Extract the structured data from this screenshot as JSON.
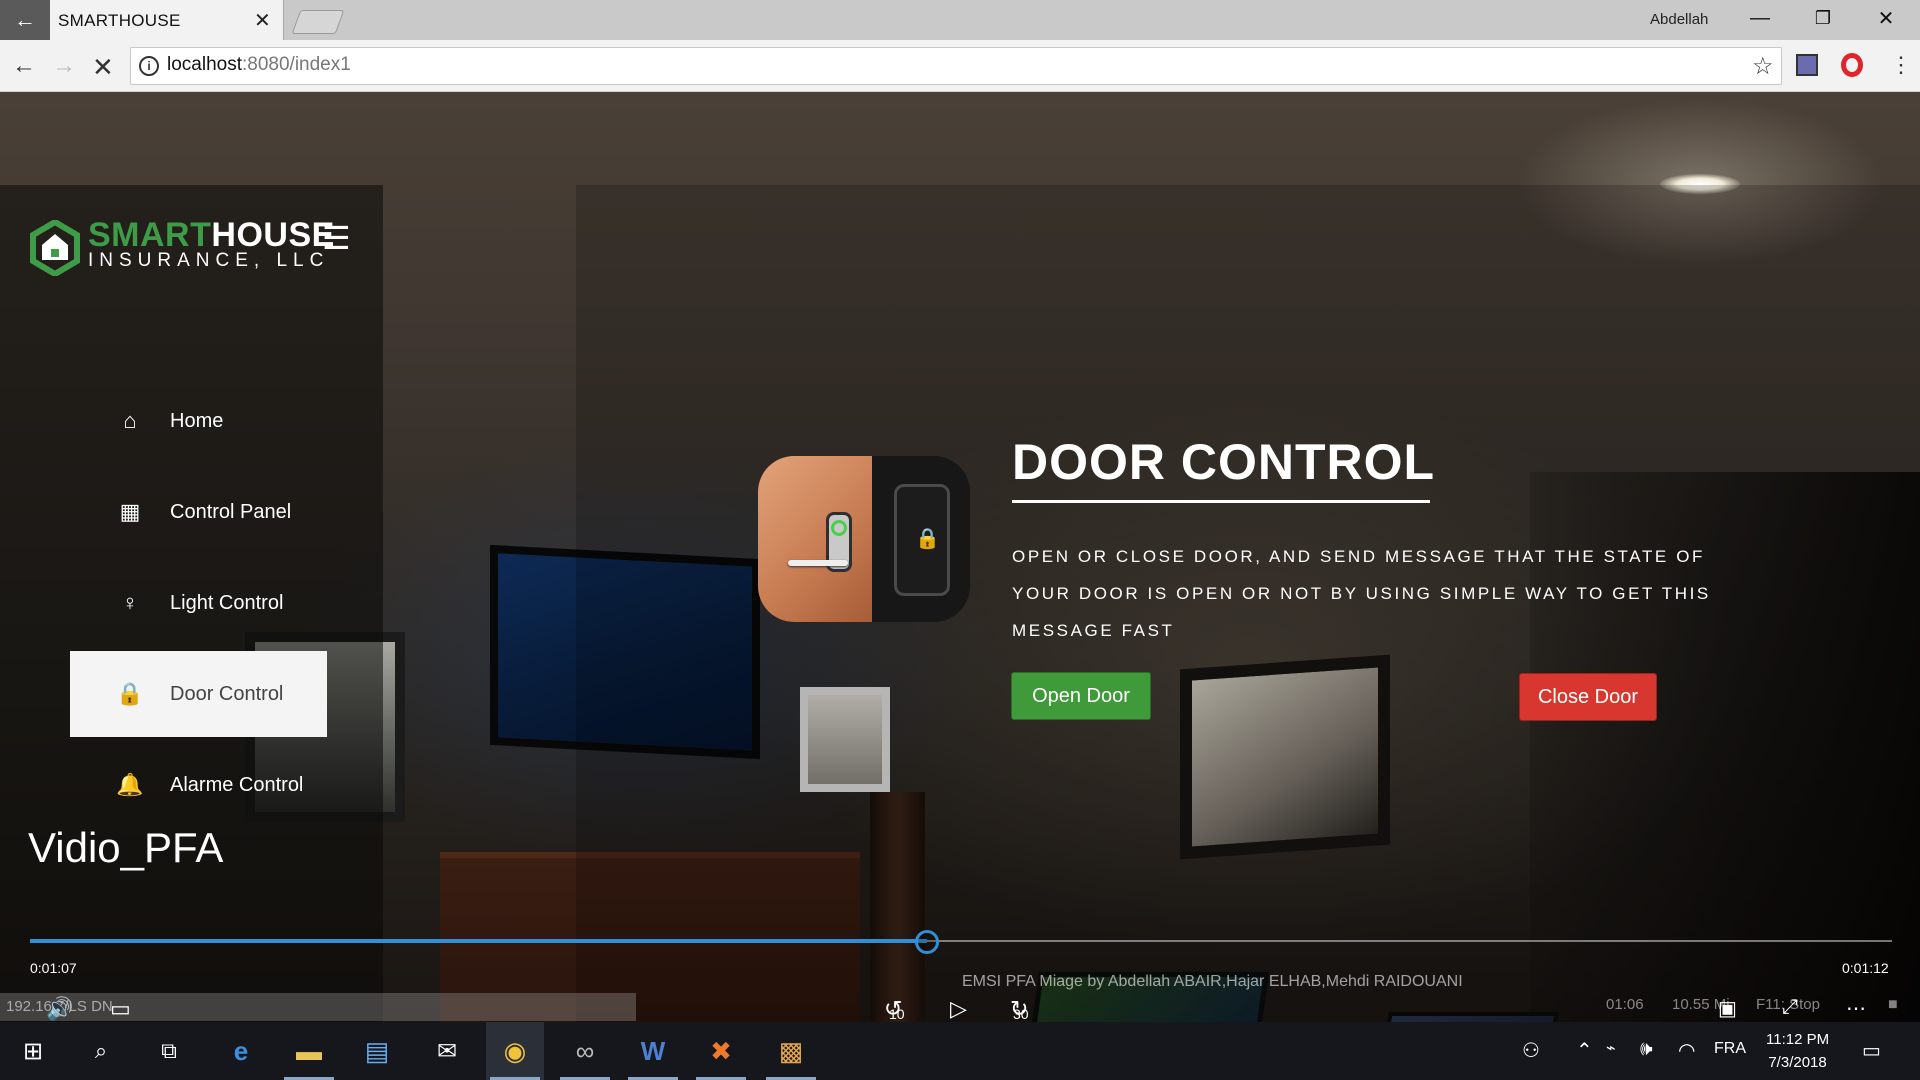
{
  "browser": {
    "tab_title": "SMARTHOUSE",
    "tab_close": "✕",
    "user": "Abdellah",
    "url_host": "localhost",
    "url_path": ":8080/index1",
    "window_controls": {
      "minimize": "—",
      "restore": "❐",
      "close": "✕"
    }
  },
  "logo": {
    "brand_green": "SMART",
    "brand_white": "HOUSE",
    "subtitle": "INSURANCE, LLC",
    "color": "#3e9b47"
  },
  "sidebar": {
    "items": [
      {
        "label": "Home",
        "icon": "home-icon",
        "glyph": "⌂"
      },
      {
        "label": "Control Panel",
        "icon": "grid-icon",
        "glyph": "▦"
      },
      {
        "label": "Light Control",
        "icon": "lightbulb-icon",
        "glyph": "♀"
      },
      {
        "label": "Door Control",
        "icon": "lock-icon",
        "glyph": "🔒"
      },
      {
        "label": "Alarme Control",
        "icon": "bell-icon",
        "glyph": "🔔"
      }
    ],
    "active_index": 3
  },
  "main": {
    "title": "DOOR CONTROL",
    "description": "Open or close door, and send message that the state of your door is open or not by using simple way to get this message fast",
    "open_button": "Open Door",
    "close_button": "Close Door",
    "open_color": "#3f9a3a",
    "close_color": "#d8372f"
  },
  "video": {
    "title": "Vidio_PFA",
    "elapsed": "0:01:07",
    "remaining": "0:01:12",
    "progress_fraction": 0.482,
    "credits": "EMSI PFA Miage by Abdellah ABAIR,Hajar ELHAB,Mehdi RAIDOUANI",
    "status_text": "192.16   7/LS   DN",
    "rewind_label": "10",
    "forward_label": "30",
    "tray_left": "01:06",
    "tray_mid": "10.55 Mi",
    "tray_right": "F11: Stop"
  },
  "taskbar": {
    "language": "FRA",
    "time": "11:12 PM",
    "date": "7/3/2018"
  }
}
